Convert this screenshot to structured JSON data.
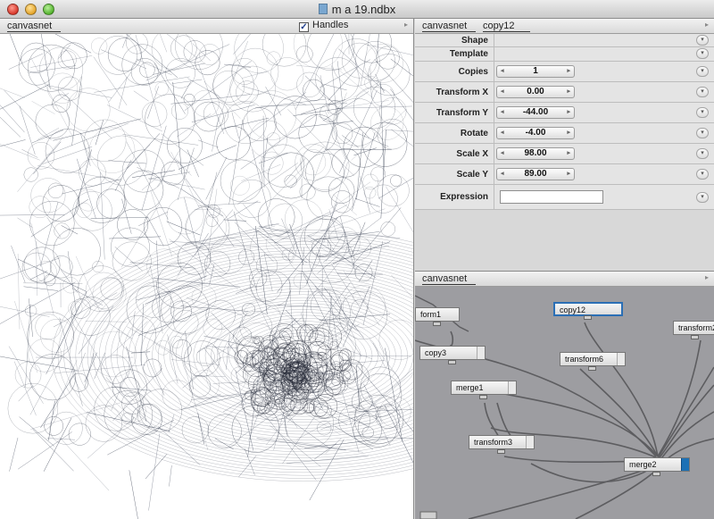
{
  "window": {
    "title": "m a 19.ndbx"
  },
  "viewer": {
    "tab_label": "canvasnet",
    "handles_label": "Handles",
    "handles_checked": true
  },
  "parameters": {
    "tab_network": "canvasnet",
    "tab_node": "copy12",
    "rows": [
      {
        "label": "Shape",
        "type": "menu",
        "value": ""
      },
      {
        "label": "Template",
        "type": "menu",
        "value": ""
      },
      {
        "label": "Copies",
        "type": "stepper",
        "value": "1"
      },
      {
        "label": "Transform X",
        "type": "stepper",
        "value": "0.00"
      },
      {
        "label": "Transform Y",
        "type": "stepper",
        "value": "-44.00"
      },
      {
        "label": "Rotate",
        "type": "stepper",
        "value": "-4.00"
      },
      {
        "label": "Scale X",
        "type": "stepper",
        "value": "98.00"
      },
      {
        "label": "Scale Y",
        "type": "stepper",
        "value": "89.00"
      },
      {
        "label": "Expression",
        "type": "text",
        "value": ""
      }
    ]
  },
  "network": {
    "tab_label": "canvasnet",
    "nodes": [
      {
        "name": "form1",
        "state": "normal"
      },
      {
        "name": "copy12",
        "state": "selected"
      },
      {
        "name": "transform2",
        "state": "normal"
      },
      {
        "name": "copy3",
        "state": "normal"
      },
      {
        "name": "transform6",
        "state": "normal"
      },
      {
        "name": "merge1",
        "state": "normal"
      },
      {
        "name": "transform3",
        "state": "normal"
      },
      {
        "name": "merge2",
        "state": "rendered"
      }
    ]
  },
  "colors": {
    "selection": "#2b6fb5",
    "rendered_flag": "#1c71b6",
    "network_bg": "#9d9da1"
  },
  "icons": [
    "window-close-icon",
    "window-minimize-icon",
    "window-zoom-icon",
    "document-icon",
    "stepper-left-icon",
    "stepper-right-icon",
    "dropdown-arrow-icon"
  ]
}
